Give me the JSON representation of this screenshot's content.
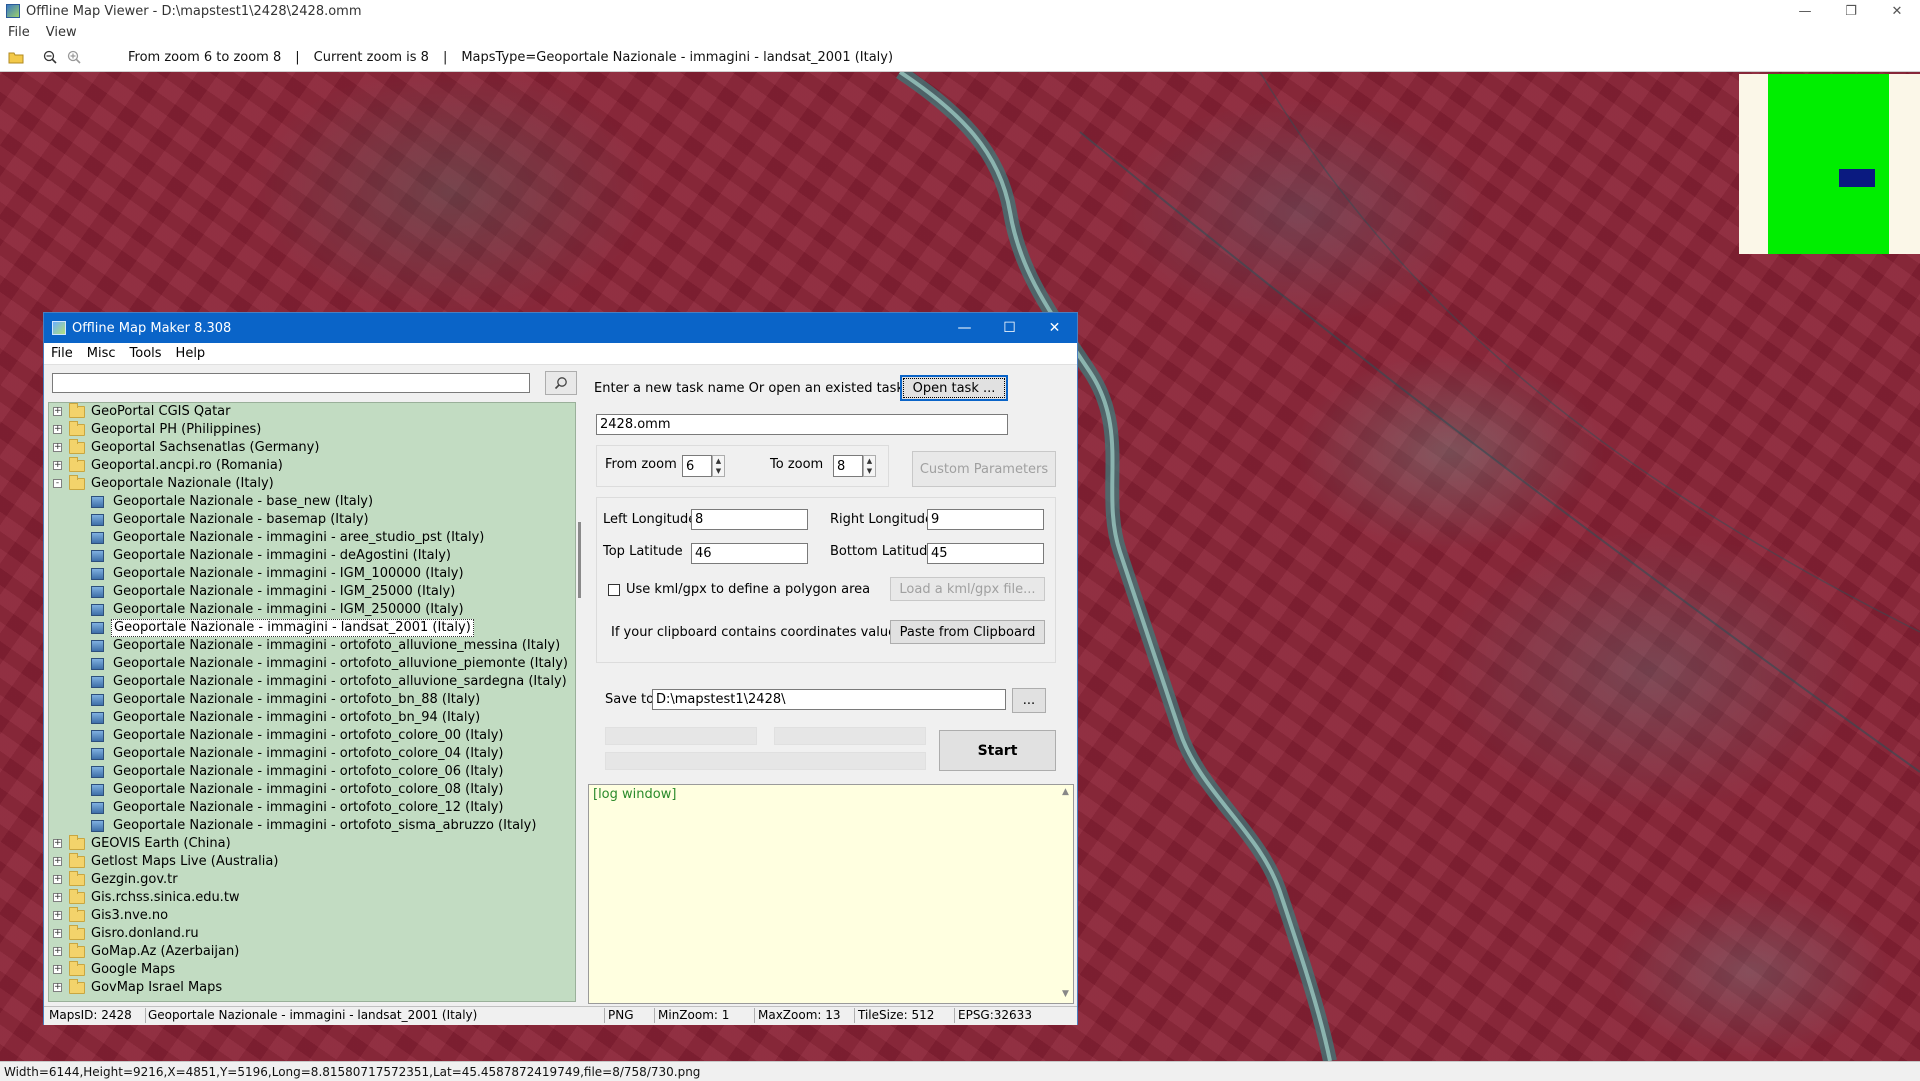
{
  "viewer": {
    "title": "Offline Map Viewer - D:\\mapstest1\\2428\\2428.omm",
    "menu": [
      "File",
      "View"
    ],
    "toolbar": {
      "zoom_range": "From zoom 6 to zoom 8",
      "separator": "|",
      "current_zoom": "Current zoom is 8",
      "maps_type": "MapsType=Geoportale Nazionale - immagini - landsat_2001 (Italy)"
    },
    "status": "Width=6144,Height=9216,X=4851,Y=5196,Long=8.81580717572351,Lat=45.4587872419749,file=8/758/730.png",
    "colors": {
      "overview_land": "#00ee00",
      "overview_viewport": "#0a1a80",
      "map_base": "#8a2236"
    }
  },
  "maker": {
    "title": "Offline Map Maker 8.308",
    "menu": [
      "File",
      "Misc",
      "Tools",
      "Help"
    ],
    "search": {
      "value": "",
      "placeholder": ""
    },
    "tree": [
      {
        "type": "folder",
        "label": "GeoPortal CGIS Qatar",
        "expander": "+"
      },
      {
        "type": "folder",
        "label": "Geoportal PH (Philippines)",
        "expander": "+"
      },
      {
        "type": "folder",
        "label": "Geoportal Sachsenatlas (Germany)",
        "expander": "+"
      },
      {
        "type": "folder",
        "label": "Geoportal.ancpi.ro (Romania)",
        "expander": "+"
      },
      {
        "type": "folder",
        "label": "Geoportale Nazionale (Italy)",
        "expander": "-",
        "open": true
      },
      {
        "type": "map",
        "label": "Geoportale Nazionale - base_new (Italy)"
      },
      {
        "type": "map",
        "label": "Geoportale Nazionale - basemap (Italy)"
      },
      {
        "type": "map",
        "label": "Geoportale Nazionale - immagini - aree_studio_pst (Italy)"
      },
      {
        "type": "map",
        "label": "Geoportale Nazionale - immagini - deAgostini (Italy)"
      },
      {
        "type": "map",
        "label": "Geoportale Nazionale - immagini - IGM_100000 (Italy)"
      },
      {
        "type": "map",
        "label": "Geoportale Nazionale - immagini - IGM_25000 (Italy)"
      },
      {
        "type": "map",
        "label": "Geoportale Nazionale - immagini - IGM_250000 (Italy)"
      },
      {
        "type": "map",
        "label": "Geoportale Nazionale - immagini - landsat_2001 (Italy)",
        "selected": true
      },
      {
        "type": "map",
        "label": "Geoportale Nazionale - immagini - ortofoto_alluvione_messina (Italy)"
      },
      {
        "type": "map",
        "label": "Geoportale Nazionale - immagini - ortofoto_alluvione_piemonte (Italy)"
      },
      {
        "type": "map",
        "label": "Geoportale Nazionale - immagini - ortofoto_alluvione_sardegna (Italy)"
      },
      {
        "type": "map",
        "label": "Geoportale Nazionale - immagini - ortofoto_bn_88 (Italy)"
      },
      {
        "type": "map",
        "label": "Geoportale Nazionale - immagini - ortofoto_bn_94 (Italy)"
      },
      {
        "type": "map",
        "label": "Geoportale Nazionale - immagini - ortofoto_colore_00 (Italy)"
      },
      {
        "type": "map",
        "label": "Geoportale Nazionale - immagini - ortofoto_colore_04 (Italy)"
      },
      {
        "type": "map",
        "label": "Geoportale Nazionale - immagini - ortofoto_colore_06 (Italy)"
      },
      {
        "type": "map",
        "label": "Geoportale Nazionale - immagini - ortofoto_colore_08 (Italy)"
      },
      {
        "type": "map",
        "label": "Geoportale Nazionale - immagini - ortofoto_colore_12 (Italy)"
      },
      {
        "type": "map",
        "label": "Geoportale Nazionale - immagini - ortofoto_sisma_abruzzo (Italy)"
      },
      {
        "type": "folder",
        "label": "GEOVIS Earth (China)",
        "expander": "+"
      },
      {
        "type": "folder",
        "label": "Getlost Maps Live (Australia)",
        "expander": "+"
      },
      {
        "type": "folder",
        "label": "Gezgin.gov.tr",
        "expander": "+"
      },
      {
        "type": "folder",
        "label": "Gis.rchss.sinica.edu.tw",
        "expander": "+"
      },
      {
        "type": "folder",
        "label": "Gis3.nve.no",
        "expander": "+"
      },
      {
        "type": "folder",
        "label": "Gisro.donland.ru",
        "expander": "+"
      },
      {
        "type": "folder",
        "label": "GoMap.Az (Azerbaijan)",
        "expander": "+"
      },
      {
        "type": "folder",
        "label": "Google Maps",
        "expander": "+"
      },
      {
        "type": "folder",
        "label": "GovMap Israel Maps",
        "expander": "+"
      }
    ],
    "task": {
      "prompt": "Enter a new task name Or open an existed task to continue:",
      "open_button": "Open task ...",
      "name_value": "2428.omm"
    },
    "zoom": {
      "from_label": "From zoom",
      "from_value": "6",
      "to_label": "To zoom",
      "to_value": "8",
      "custom_button": "Custom Parameters"
    },
    "coords": {
      "left_lon_label": "Left Longitude",
      "left_lon_value": "8",
      "right_lon_label": "Right Longitude",
      "right_lon_value": "9",
      "top_lat_label": "Top Latitude",
      "top_lat_value": "46",
      "bottom_lat_label": "Bottom Latitude",
      "bottom_lat_value": "45",
      "kml_label": "Use kml/gpx to define a polygon area",
      "kml_button": "Load a kml/gpx file...",
      "clipboard_label": "If your clipboard contains coordinates values:",
      "clipboard_button": "Paste from Clipboard"
    },
    "save": {
      "label": "Save to:",
      "value": "D:\\mapstest1\\2428\\",
      "browse_button": "...",
      "start_button": "Start"
    },
    "log": "[log window]",
    "status": {
      "maps_id": "MapsID: 2428",
      "map_name": "Geoportale Nazionale - immagini - landsat_2001 (Italy)",
      "format": "PNG",
      "min_zoom": "MinZoom: 1",
      "max_zoom": "MaxZoom: 13",
      "tile_size": "TileSize: 512",
      "epsg": "EPSG:32633"
    }
  }
}
